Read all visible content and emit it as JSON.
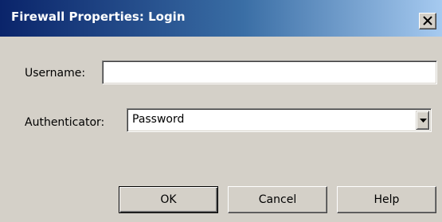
{
  "window": {
    "title": "Firewall Properties: Login"
  },
  "form": {
    "username_label": "Username:",
    "username_value": "",
    "authenticator_label": "Authenticator:",
    "authenticator_selected": "Password"
  },
  "buttons": {
    "ok": "OK",
    "cancel": "Cancel",
    "help": "Help"
  },
  "icons": {
    "close": "close-icon",
    "dropdown": "chevron-down-icon"
  },
  "colors": {
    "titlebar_start": "#0a246a",
    "titlebar_end": "#a6caf0",
    "dialog_background": "#d4d0c8"
  }
}
